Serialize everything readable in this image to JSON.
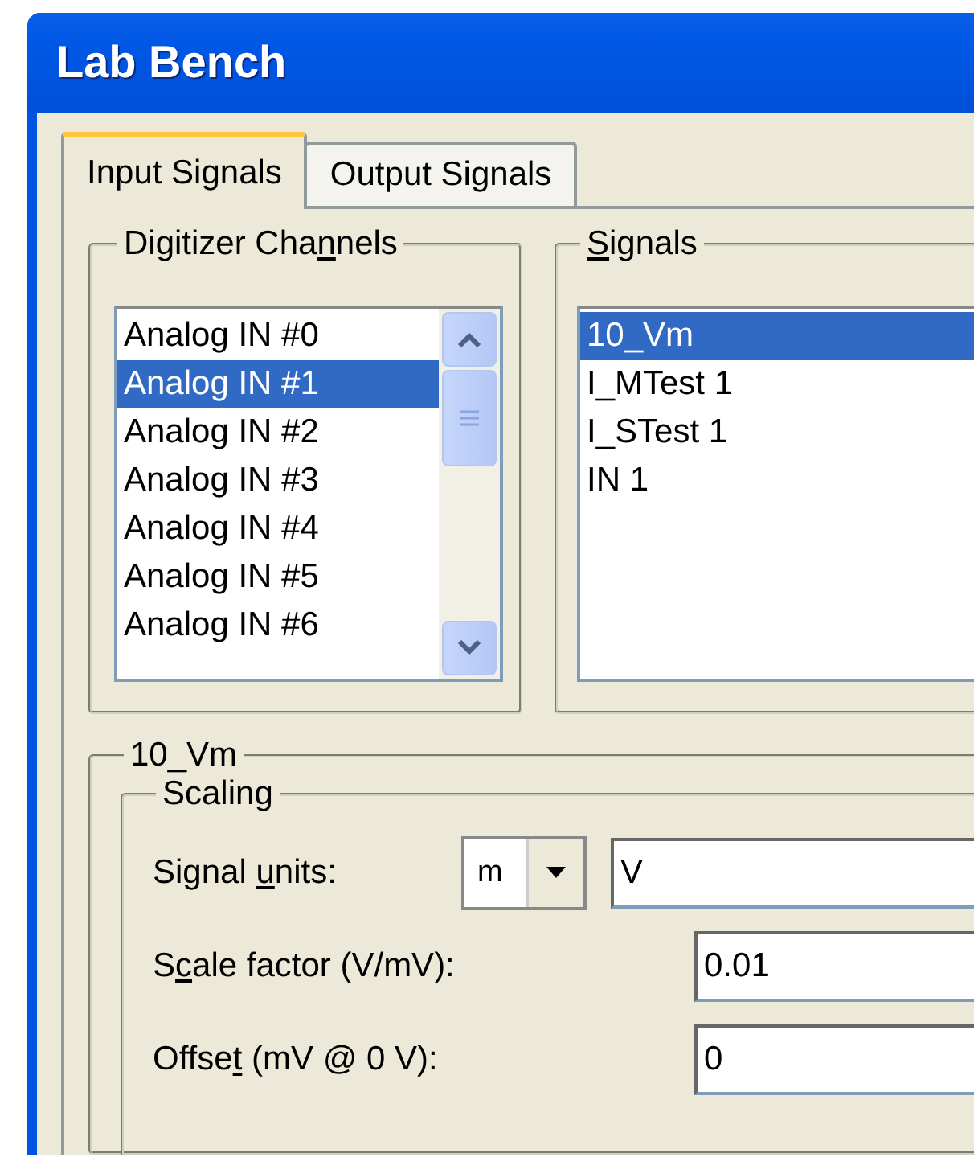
{
  "window": {
    "title": "Lab Bench"
  },
  "tabs": [
    {
      "label": "Input Signals",
      "selected": true
    },
    {
      "label": "Output Signals",
      "selected": false
    }
  ],
  "digitizer_channels": {
    "label": {
      "before": "Digitizer Cha",
      "key": "n",
      "after": "nels"
    },
    "items": [
      {
        "label": "Analog IN #0",
        "selected": false
      },
      {
        "label": "Analog IN #1",
        "selected": true
      },
      {
        "label": "Analog IN #2",
        "selected": false
      },
      {
        "label": "Analog IN #3",
        "selected": false
      },
      {
        "label": "Analog IN #4",
        "selected": false
      },
      {
        "label": "Analog IN #5",
        "selected": false
      },
      {
        "label": "Analog IN #6",
        "selected": false
      }
    ]
  },
  "signals": {
    "label": {
      "key": "S",
      "after": "ignals"
    },
    "items": [
      {
        "label": "10_Vm",
        "selected": true
      },
      {
        "label": "I_MTest 1",
        "selected": false
      },
      {
        "label": "I_STest 1",
        "selected": false
      },
      {
        "label": "IN 1",
        "selected": false
      }
    ]
  },
  "signal_group": {
    "title": "10_Vm",
    "scaling": {
      "title": "Scaling",
      "signal_units": {
        "label": {
          "before": "Signal ",
          "key": "u",
          "after": "nits:"
        },
        "prefix": "m",
        "unit": "V"
      },
      "scale_factor": {
        "label": {
          "before": "S",
          "key": "c",
          "after": "ale factor (V/mV):"
        },
        "value": "0.01"
      },
      "offset": {
        "label": {
          "before": "Offse",
          "key": "t",
          "after": " (mV @ 0 V):"
        },
        "value": "0"
      }
    }
  }
}
